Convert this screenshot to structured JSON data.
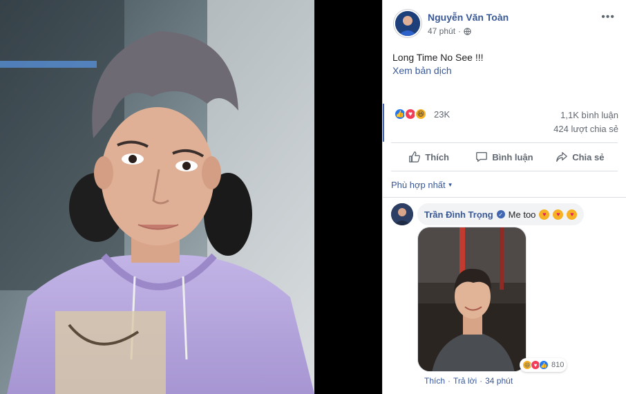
{
  "post": {
    "author": "Nguyễn Văn Toàn",
    "time": "47 phút",
    "text": "Long Time No See !!!",
    "translate": "Xem bản dịch",
    "reaction_count": "23K",
    "comment_count": "1,1K bình luận",
    "share_count": "424 lượt chia sẻ"
  },
  "actions": {
    "like": "Thích",
    "comment": "Bình luận",
    "share": "Chia sẻ"
  },
  "sort": {
    "label": "Phù hợp nhất"
  },
  "comment": {
    "author": "Trần Đình Trọng",
    "text": "Me too",
    "reaction_count": "810",
    "like": "Thích",
    "reply": "Trả lời",
    "time": "34 phút",
    "separator": "·"
  },
  "icons": {
    "globe": "globe-icon",
    "more": "more-icon",
    "like": "thumbs-up-icon",
    "comment": "comment-icon",
    "share": "share-icon",
    "verified": "verified-icon"
  },
  "colors": {
    "link": "#385898",
    "like": "#2078f4",
    "love": "#f33e58",
    "haha": "#f7b125"
  }
}
